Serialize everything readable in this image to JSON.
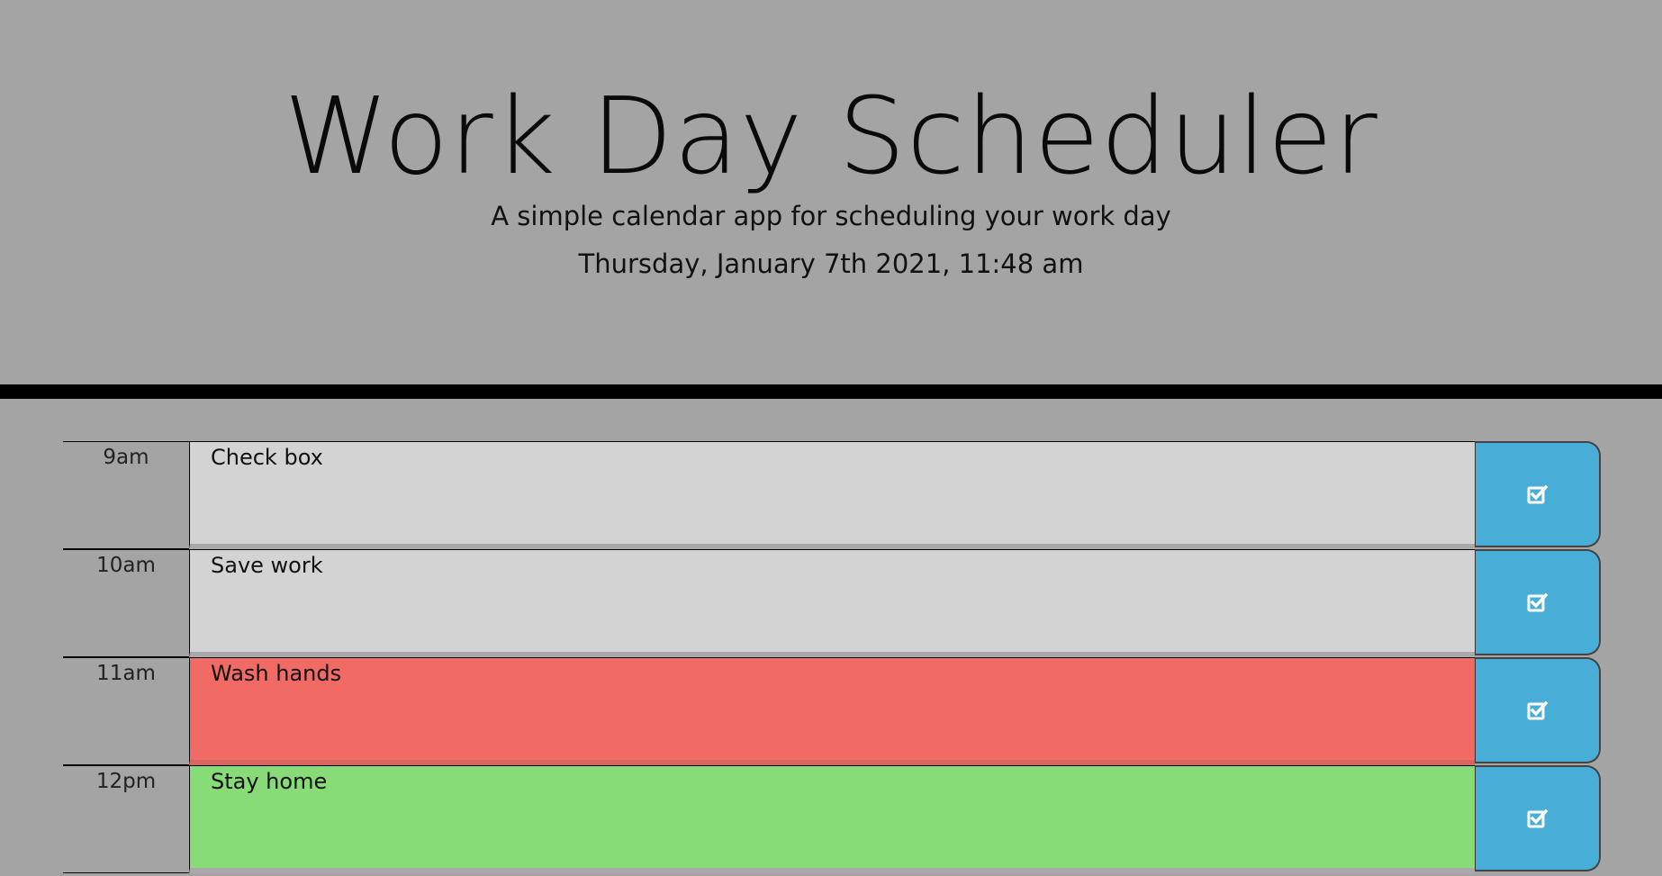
{
  "header": {
    "title": "Work Day Scheduler",
    "subtitle": "A simple calendar app for scheduling your work day",
    "current_day": "Thursday, January 7th 2021, 11:48 am"
  },
  "colors": {
    "background": "#a4a4a4",
    "past": "#d3d3d3",
    "present": "#f16a63",
    "future": "#88dc78",
    "save_button": "#48aed7"
  },
  "time_blocks": [
    {
      "hour": "9am",
      "text": "Check box",
      "state": "past",
      "save_icon": "save-check-icon"
    },
    {
      "hour": "10am",
      "text": "Save work",
      "state": "past",
      "save_icon": "save-check-icon"
    },
    {
      "hour": "11am",
      "text": "Wash hands",
      "state": "present",
      "save_icon": "save-check-icon"
    },
    {
      "hour": "12pm",
      "text": "Stay home",
      "state": "future",
      "save_icon": "save-check-icon"
    }
  ]
}
